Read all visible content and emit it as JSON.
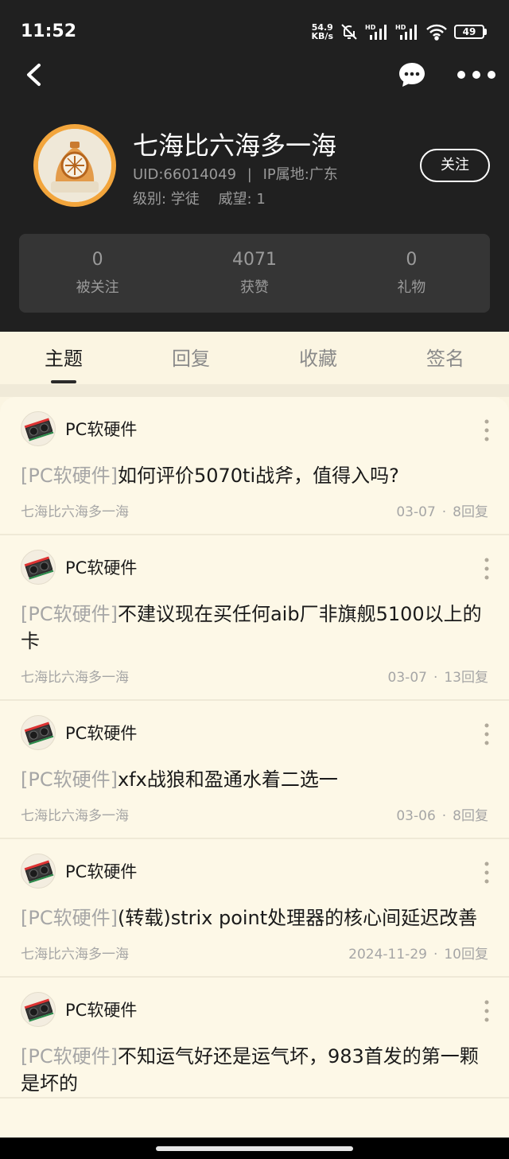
{
  "status_bar": {
    "time": "11:52",
    "net_speed_value": "54.9",
    "net_speed_unit": "KB/s",
    "battery": "49"
  },
  "profile": {
    "username": "七海比六海多一海",
    "uid": "UID:66014049",
    "separator": "|",
    "ip_location": "IP属地:广东",
    "level": "级别: 学徒",
    "prestige": "威望: 1",
    "follow_label": "关注",
    "avatar_color": "#f2a53c"
  },
  "stats": [
    {
      "value": "0",
      "label": "被关注"
    },
    {
      "value": "4071",
      "label": "获赞"
    },
    {
      "value": "0",
      "label": "礼物"
    }
  ],
  "tabs": [
    {
      "label": "主题",
      "active": true
    },
    {
      "label": "回复",
      "active": false
    },
    {
      "label": "收藏",
      "active": false
    },
    {
      "label": "签名",
      "active": false
    }
  ],
  "posts": [
    {
      "forum": "PC软硬件",
      "tag": "[PC软硬件]",
      "title": "如何评价5070ti战斧，值得入吗?",
      "author": "七海比六海多一海",
      "date": "03-07",
      "dot": "·",
      "replies": "8回复"
    },
    {
      "forum": "PC软硬件",
      "tag": "[PC软硬件]",
      "title": "不建议现在买任何aib厂非旗舰5100以上的卡",
      "author": "七海比六海多一海",
      "date": "03-07",
      "dot": "·",
      "replies": "13回复"
    },
    {
      "forum": "PC软硬件",
      "tag": "[PC软硬件]",
      "title": "xfx战狼和盈通水着二选一",
      "author": "七海比六海多一海",
      "date": "03-06",
      "dot": "·",
      "replies": "8回复"
    },
    {
      "forum": "PC软硬件",
      "tag": "[PC软硬件]",
      "title": "(转载)strix point处理器的核心间延迟改善",
      "author": "七海比六海多一海",
      "date": "2024-11-29",
      "dot": "·",
      "replies": "10回复"
    },
    {
      "forum": "PC软硬件",
      "tag": "[PC软硬件]",
      "title": "不知运气好还是运气坏，983首发的第一颗是坏的",
      "author": "",
      "date": "",
      "dot": "",
      "replies": ""
    }
  ]
}
